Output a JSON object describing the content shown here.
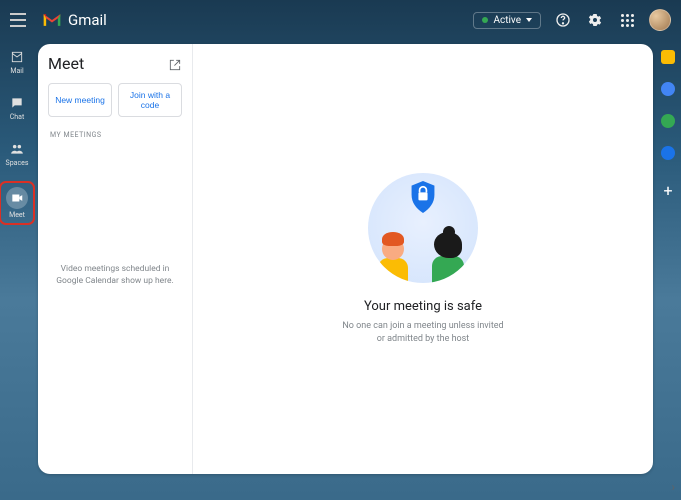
{
  "header": {
    "app_name": "Gmail",
    "status_label": "Active"
  },
  "nav": {
    "items": [
      {
        "id": "mail",
        "label": "Mail"
      },
      {
        "id": "chat",
        "label": "Chat"
      },
      {
        "id": "spaces",
        "label": "Spaces"
      },
      {
        "id": "meet",
        "label": "Meet"
      }
    ]
  },
  "meet_panel": {
    "title": "Meet",
    "new_meeting_label": "New meeting",
    "join_code_label": "Join with a code",
    "section_label": "My Meetings",
    "empty_line1": "Video meetings scheduled in",
    "empty_line2": "Google Calendar show up here."
  },
  "main": {
    "safe_title": "Your meeting is safe",
    "safe_sub_line1": "No one can join a meeting unless invited",
    "safe_sub_line2": "or admitted by the host"
  }
}
